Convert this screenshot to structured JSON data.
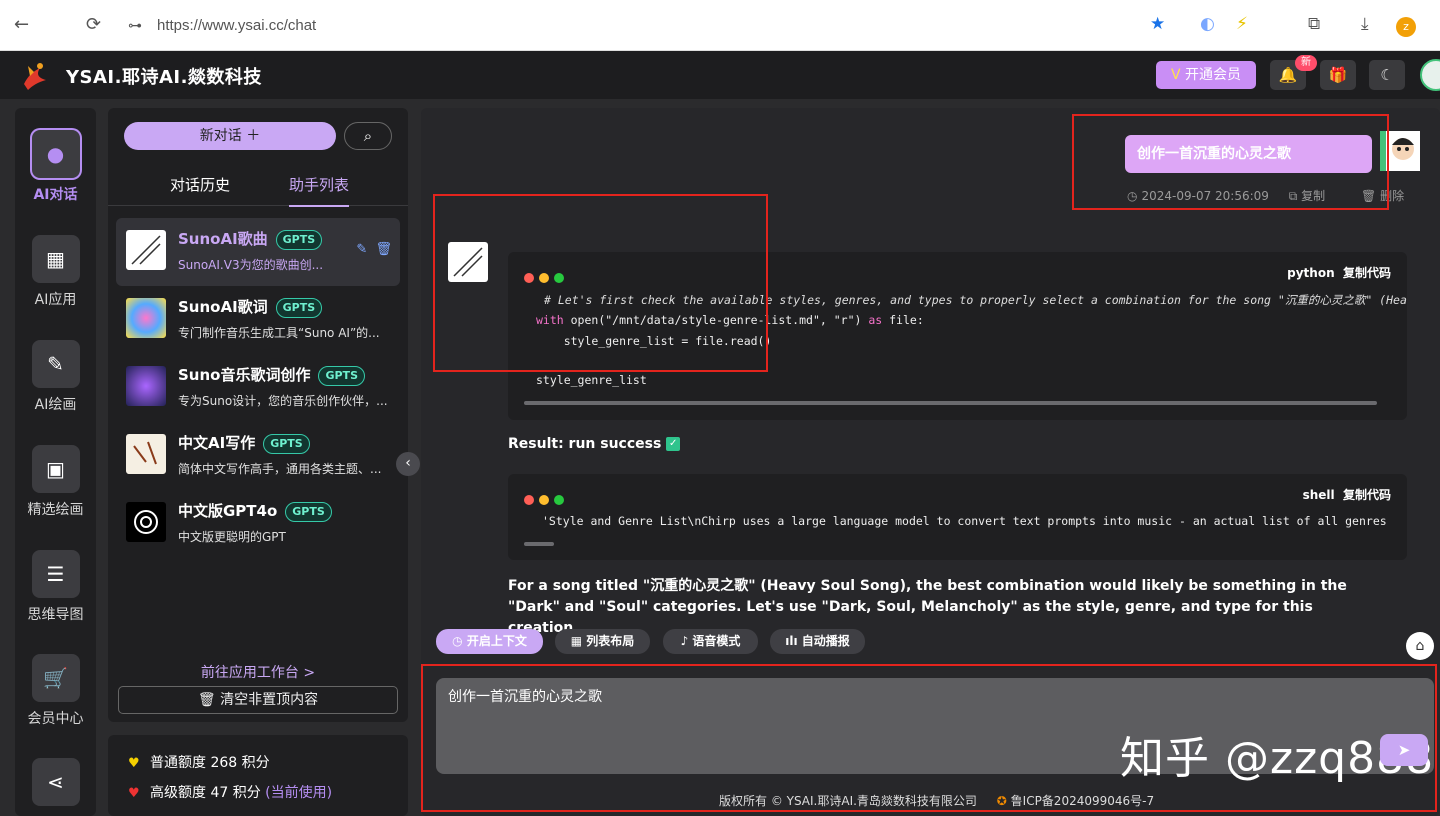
{
  "browser": {
    "url": "https://www.ysai.cc/chat",
    "back": "←",
    "reload": "⟳",
    "site_info": "⊶",
    "profile_initial": "z"
  },
  "header": {
    "title": "YSAI.耶诗AI.燚数科技",
    "vip_label": "开通会员",
    "new_badge": "新",
    "accent": "#c9a8f4"
  },
  "rail": {
    "items": [
      {
        "label": "AI对话",
        "icon": "chat-icon",
        "glyph": "💬"
      },
      {
        "label": "AI应用",
        "icon": "apps-icon",
        "glyph": "▦"
      },
      {
        "label": "AI绘画",
        "icon": "brush-icon",
        "glyph": "✎"
      },
      {
        "label": "精选绘画",
        "icon": "image-icon",
        "glyph": "▣"
      },
      {
        "label": "思维导图",
        "icon": "mindmap-icon",
        "glyph": "☰"
      },
      {
        "label": "会员中心",
        "icon": "cart-icon",
        "glyph": "🛒"
      },
      {
        "label": "",
        "icon": "share-icon",
        "glyph": "⋖"
      }
    ]
  },
  "sidebar": {
    "new_chat": "新对话 ＋",
    "tabs": [
      "对话历史",
      "助手列表"
    ],
    "assistants": [
      {
        "name": "SunoAI歌曲",
        "badge": "GPTS",
        "desc": "SunoAI.V3为您的歌曲创..."
      },
      {
        "name": "SunoAI歌词",
        "badge": "GPTS",
        "desc": "专门制作音乐生成工具“Suno AI”的..."
      },
      {
        "name": "Suno音乐歌词创作",
        "badge": "GPTS",
        "desc": "专为Suno设计，您的音乐创作伙伴，..."
      },
      {
        "name": "中文AI写作",
        "badge": "GPTS",
        "desc": "简体中文写作高手，通用各类主题、..."
      },
      {
        "name": "中文版GPT4o",
        "badge": "GPTS",
        "desc": "中文版更聪明的GPT"
      }
    ],
    "goto_workspace": "前往应用工作台 >",
    "clear_label": "清空非置顶内容"
  },
  "quota": {
    "normal": "普通额度 268 积分",
    "premium": "高级额度 47 积分",
    "current": "(当前使用)"
  },
  "chat": {
    "user_message": "创作一首沉重的心灵之歌",
    "timestamp": "2024-09-07 20:56:09",
    "copy": "复制",
    "delete": "删除",
    "code1": {
      "lang": "python",
      "copy": "复制代码",
      "comment": "# Let's first check the available styles, genres, and types to properly select a combination for the song \"沉重的心灵之歌\" (Heavy Soul Song)",
      "kw_with": "with",
      "open_call": " open(\"/mnt/data/style-genre-list.md\", \"r\") ",
      "kw_as": "as",
      "as_target": " file:",
      "line3": "    style_genre_list = file.read()",
      "line4": "style_genre_list"
    },
    "result": "Result: run success",
    "code2": {
      "lang": "shell",
      "copy": "复制代码",
      "line1": "'Style and Genre List\\nChirp uses a large language model to convert text prompts into music - an actual list of all genres and sty"
    },
    "paragraph": "For a song titled \"沉重的心灵之歌\" (Heavy Soul Song), the best combination would likely be something in the \"Dark\" and \"Soul\" categories. Let's use \"Dark, Soul, Melancholy\" as the style, genre, and type for this creation."
  },
  "toolbar": {
    "context": "开启上下文",
    "layout": "列表布局",
    "voice": "语音模式",
    "autoplay": "自动播报"
  },
  "input": {
    "value": "创作一首沉重的心灵之歌"
  },
  "watermark": "知乎 @zzq888",
  "footer": {
    "copyright": "版权所有 © YSAI.耶诗AI.青岛燚数科技有限公司",
    "icp": "鲁ICP备2024099046号-7"
  }
}
